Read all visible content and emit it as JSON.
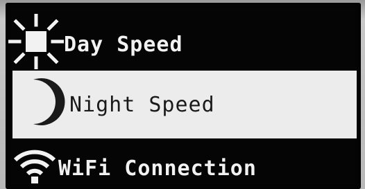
{
  "menu": {
    "items": [
      {
        "label": "Day Speed",
        "icon": "sun-icon",
        "selected": false
      },
      {
        "label": "Night Speed",
        "icon": "moon-icon",
        "selected": true
      },
      {
        "label": "WiFi Connection",
        "icon": "wifi-icon",
        "selected": false
      }
    ]
  },
  "colors": {
    "screen_background": "#050505",
    "text": "#f2f2f2",
    "selected_background": "#ececec",
    "selected_text": "#1a1a1a"
  }
}
